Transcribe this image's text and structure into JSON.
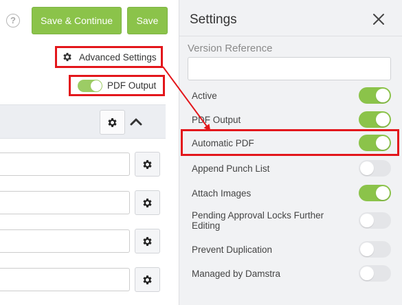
{
  "toolbar": {
    "help_icon": "question-circle-icon",
    "save_continue_label": "Save & Continue",
    "save_label": "Save"
  },
  "form": {
    "advanced_settings_label": "Advanced Settings",
    "pdf_output_label": "PDF Output",
    "pdf_output_on": true
  },
  "settings": {
    "title": "Settings",
    "version_reference_label": "Version Reference",
    "version_reference_value": "",
    "items": [
      {
        "label": "Active",
        "on": true
      },
      {
        "label": "PDF Output",
        "on": true
      },
      {
        "label": "Automatic PDF",
        "on": true
      },
      {
        "label": "Append Punch List",
        "on": false
      },
      {
        "label": "Attach Images",
        "on": true
      },
      {
        "label": "Pending Approval Locks Further Editing",
        "on": false
      },
      {
        "label": "Prevent Duplication",
        "on": false
      },
      {
        "label": "Managed by Damstra",
        "on": false
      }
    ]
  },
  "colors": {
    "accent": "#8bc34a",
    "highlight": "#e3161b",
    "panel_bg": "#f1f2f4"
  }
}
